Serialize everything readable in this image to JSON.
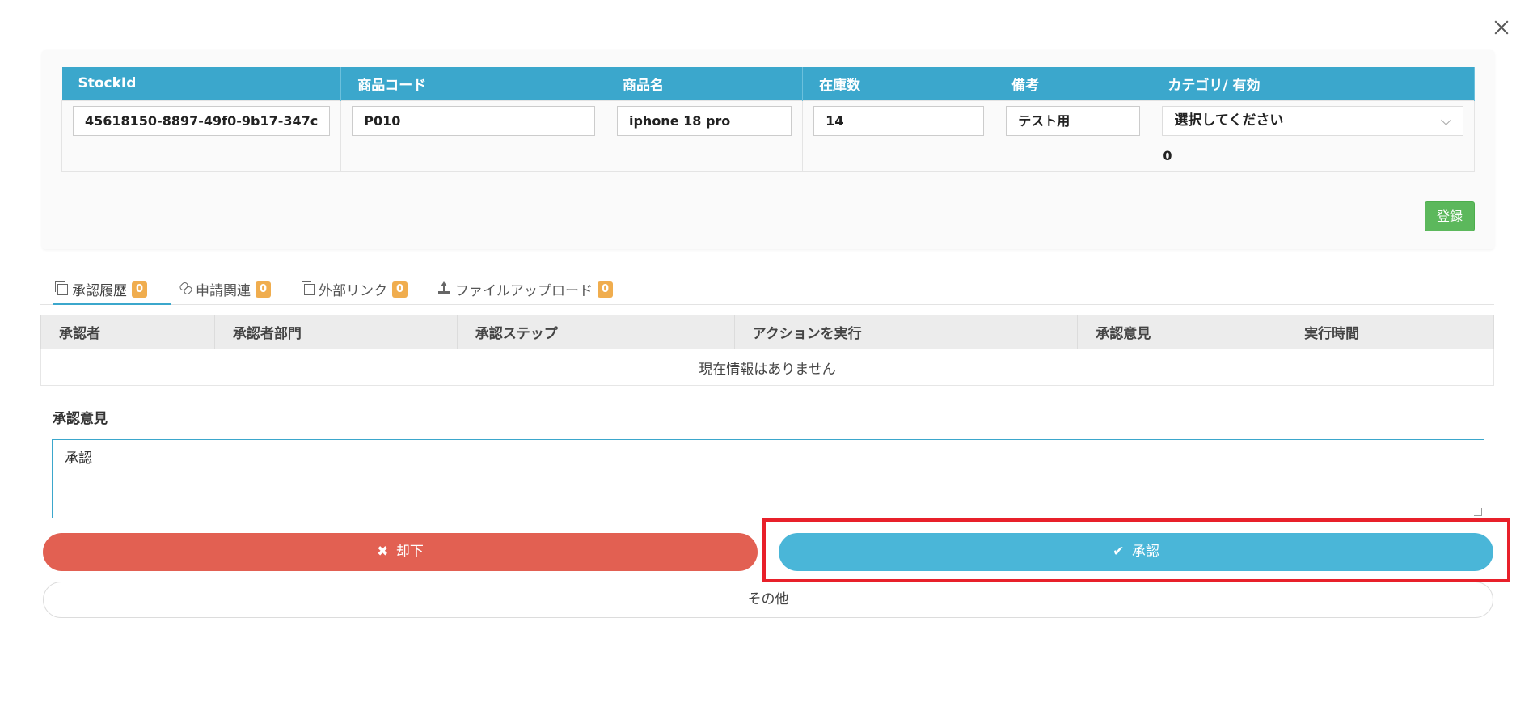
{
  "stock_table": {
    "headers": [
      "StockId",
      "商品コード",
      "商品名",
      "在庫数",
      "備考",
      "カテゴリ/ 有効"
    ],
    "row": {
      "stock_id": "45618150-8897-49f0-9b17-347c",
      "product_code": "P010",
      "product_name": "iphone 18 pro",
      "quantity": "14",
      "remarks": "テスト用",
      "category_placeholder": "選択してください",
      "enabled_value": "0"
    }
  },
  "register_button": "登録",
  "tabs": [
    {
      "label": "承認履歴",
      "count": "0",
      "icon": "copy-icon"
    },
    {
      "label": "申請関連",
      "count": "0",
      "icon": "link-icon"
    },
    {
      "label": "外部リンク",
      "count": "0",
      "icon": "copy-icon"
    },
    {
      "label": "ファイルアップロード",
      "count": "0",
      "icon": "upload-icon"
    }
  ],
  "approval_table": {
    "headers": [
      "承認者",
      "承認者部門",
      "承認ステップ",
      "アクションを実行",
      "承認意見",
      "実行時間"
    ],
    "empty_message": "現在情報はありません"
  },
  "opinion": {
    "label": "承認意見",
    "value": "承認"
  },
  "actions": {
    "reject": "却下",
    "approve": "承認",
    "other": "その他"
  },
  "colors": {
    "header_blue": "#3ba7cc",
    "reject_red": "#e26052",
    "approve_blue": "#4ab6d8",
    "register_green": "#5cb85c",
    "badge_orange": "#f0ad4e",
    "highlight_red": "#e8202a"
  }
}
